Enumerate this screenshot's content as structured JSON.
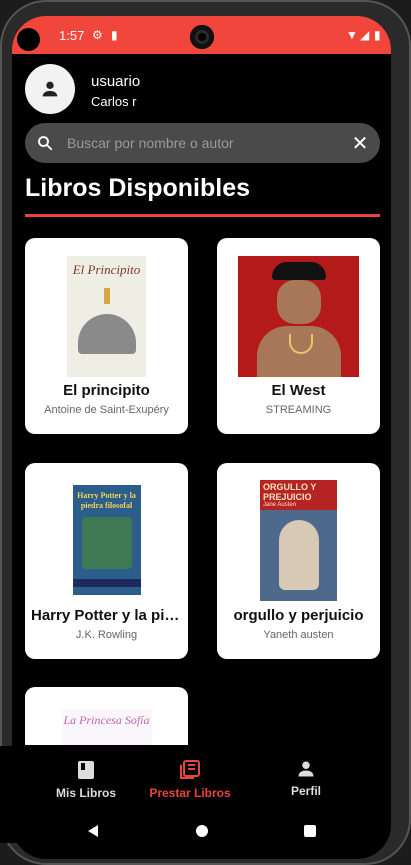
{
  "status_bar": {
    "time": "1:57",
    "accent": "#f0463c"
  },
  "user": {
    "username": "usuario",
    "name": "Carlos r"
  },
  "search": {
    "placeholder": "Buscar por nombre o autor"
  },
  "page_title": "Libros Disponibles",
  "books": [
    {
      "title": "El principito",
      "author": "Antoine de Saint-Exupéry",
      "cover_text": "El Principito"
    },
    {
      "title": "El West",
      "author": "STREAMING"
    },
    {
      "title": "Harry Potter y la pie...",
      "author": "J.K. Rowling",
      "cover_text": "Harry Potter y la piedra filosofal"
    },
    {
      "title": "orgullo y perjuicio",
      "author": "Yaneth austen",
      "cover_text": "ORGULLO Y PREJUICIO",
      "cover_author": "Jane Austen"
    },
    {
      "title": "",
      "author": "",
      "cover_text": "La Princesa Sofía"
    }
  ],
  "nav": {
    "items": [
      {
        "label": "Mis Libros",
        "icon": "book-icon"
      },
      {
        "label": "Prestar Libros",
        "icon": "library-icon",
        "active": true
      },
      {
        "label": "Perfil",
        "icon": "person-icon"
      }
    ],
    "active_color": "#e8453c"
  }
}
